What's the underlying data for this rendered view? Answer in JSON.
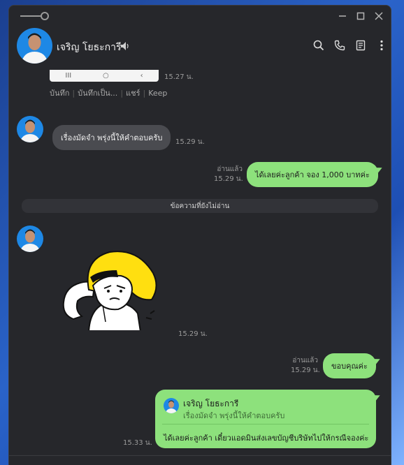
{
  "chat": {
    "contact_name": "เจริญ โยธะการี",
    "avatar_icon": "person-photo-avatar",
    "speaker_icon": "speaker-icon"
  },
  "window_controls": [
    "minimize-icon",
    "maximize-icon",
    "close-icon"
  ],
  "header_icons": [
    "search-icon",
    "phone-icon",
    "notes-icon",
    "more-vertical-icon"
  ],
  "messages": {
    "image_msg": {
      "time": "15.27 น.",
      "actions": [
        "บันทึก",
        "บันทึกเป็น...",
        "แชร์",
        "Keep"
      ]
    },
    "msg1": {
      "text": "เรื่องมัดจำ พรุ่งนี้ให้คำตอบครับ",
      "time": "15.29 น."
    },
    "msg2": {
      "text": "ได้เลยค่ะลูกค้า จอง 1,000 บาทค่ะ",
      "read": "อ่านแล้ว",
      "time": "15.29 น."
    },
    "unread_divider": "ข้อความที่ยังไม่อ่าน",
    "sticker": {
      "time": "15.29 น."
    },
    "msg3": {
      "text": "ขอบคุณค่ะ",
      "read": "อ่านแล้ว",
      "time": "15.29 น."
    },
    "reply": {
      "quoted_name": "เจริญ โยธะการี",
      "quoted_text": "เรื่องมัดจำ พรุ่งนี้ให้คำตอบครับ",
      "text": "ได้เลยค่ะลูกค้า เดี๋ยวแอดมินส่งเลขบัญชีบริษัทไปให้กรณีจองค่ะ",
      "time": "15.33 น."
    }
  },
  "colors": {
    "window_bg": "#26272b",
    "bubble_out": "#8de17c",
    "bubble_in": "#4a4b50"
  }
}
